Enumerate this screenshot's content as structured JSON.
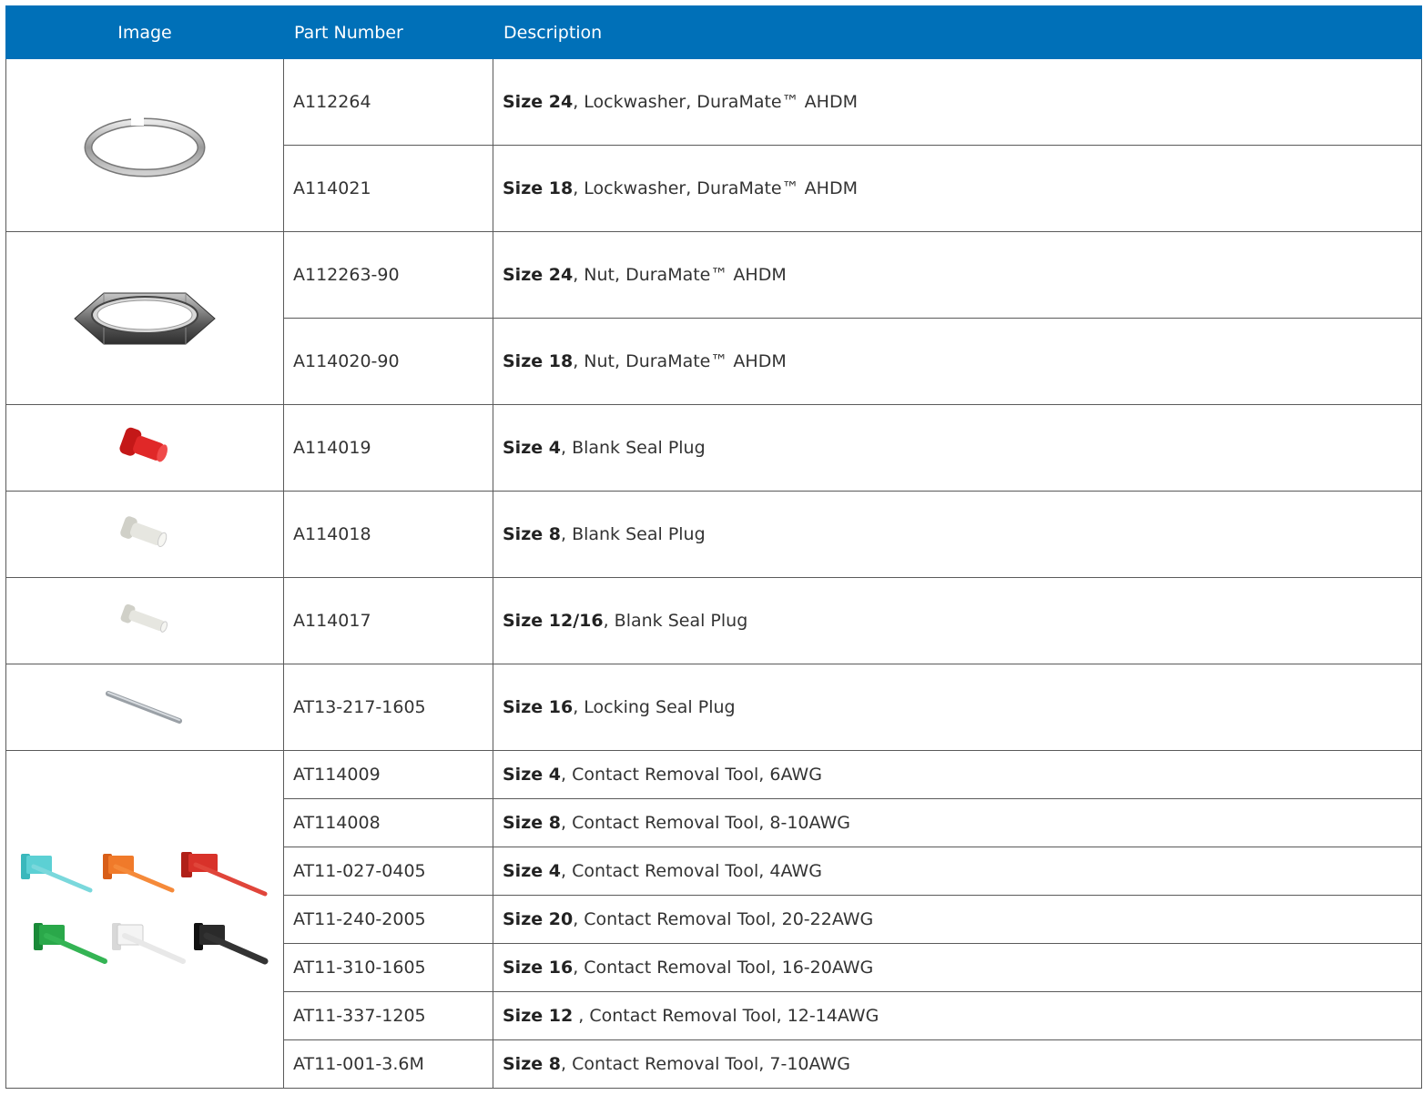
{
  "headers": {
    "image": "Image",
    "part_number": "Part Number",
    "description": "Description"
  },
  "rows": [
    {
      "part": "A112264",
      "size": "Size 24",
      "rest": ", Lockwasher, DuraMate™ AHDM"
    },
    {
      "part": "A114021",
      "size": "Size 18",
      "rest": ", Lockwasher, DuraMate™ AHDM"
    },
    {
      "part": "A112263-90",
      "size": "Size 24",
      "rest": ", Nut, DuraMate™ AHDM"
    },
    {
      "part": "A114020-90",
      "size": "Size 18",
      "rest": ", Nut, DuraMate™ AHDM"
    },
    {
      "part": "A114019",
      "size": "Size 4",
      "rest": ", Blank Seal Plug"
    },
    {
      "part": "A114018",
      "size": "Size 8",
      "rest": ", Blank Seal Plug"
    },
    {
      "part": "A114017",
      "size": "Size 12/16",
      "rest": ", Blank Seal Plug"
    },
    {
      "part": "AT13-217-1605",
      "size": "Size 16",
      "rest": ", Locking Seal Plug"
    },
    {
      "part": "AT114009",
      "size": "Size 4",
      "rest": ", Contact Removal Tool, 6AWG"
    },
    {
      "part": "AT114008",
      "size": "Size 8",
      "rest": ", Contact Removal Tool, 8-10AWG"
    },
    {
      "part": "AT11-027-0405",
      "size": "Size 4",
      "rest": ", Contact Removal Tool, 4AWG"
    },
    {
      "part": "AT11-240-2005",
      "size": "Size 20",
      "rest": ", Contact Removal Tool, 20-22AWG"
    },
    {
      "part": "AT11-310-1605",
      "size": "Size 16",
      "rest": ", Contact Removal Tool, 16-20AWG"
    },
    {
      "part": "AT11-337-1205",
      "size": "Size 12",
      "rest": " , Contact Removal Tool, 12-14AWG"
    },
    {
      "part": "AT11-001-3.6M",
      "size": "Size 8",
      "rest": ", Contact Removal Tool, 7-10AWG"
    }
  ],
  "images": {
    "lockwasher": "lockwasher-image",
    "nut": "hex-nut-image",
    "plug_red": "red-seal-plug-image",
    "plug_white": "white-seal-plug-image",
    "plug_white_small": "white-seal-plug-small-image",
    "locking_plug": "locking-seal-plug-image",
    "removal_tools": "removal-tools-image"
  },
  "colors": {
    "header_bg": "#0070b8",
    "header_text": "#ffffff",
    "border": "#5a5a5a",
    "tool_cyan": "#4cc8cc",
    "tool_orange": "#f07a2a",
    "tool_red": "#d8322a",
    "tool_green": "#2aa84a",
    "tool_white": "#f0f0f0",
    "tool_black": "#222222"
  }
}
